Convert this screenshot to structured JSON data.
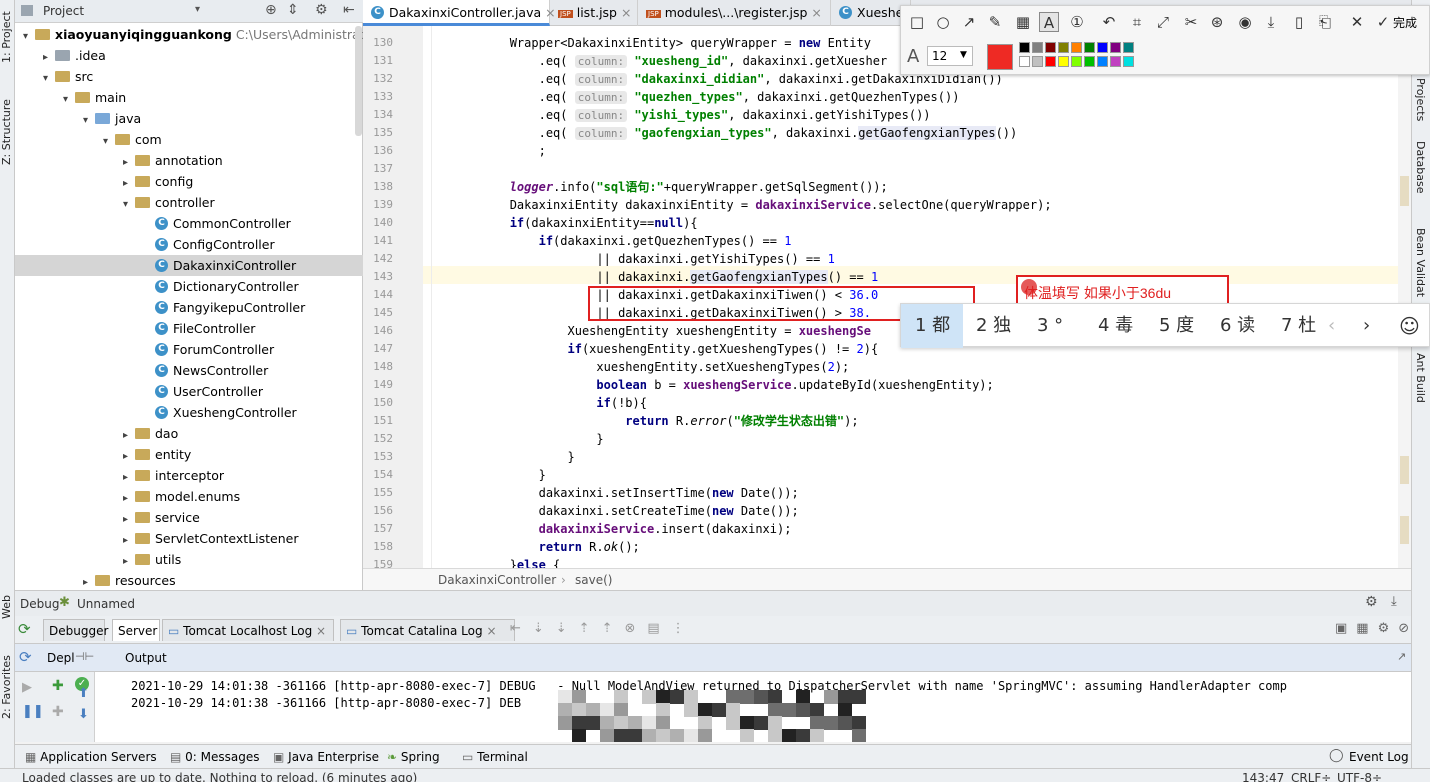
{
  "left_strip": {
    "project": "1: Project",
    "structure": "Z: Structure",
    "web": "Web",
    "favorites": "2: Favorites"
  },
  "project_panel": {
    "title": "Project",
    "rows": [
      {
        "indent": 0,
        "arrow": "▾",
        "icon": "folder",
        "label": "xiaoyuanyiqingguankong",
        "extra": "C:\\Users\\Administrator\\D",
        "bold": true
      },
      {
        "indent": 1,
        "arrow": "▸",
        "icon": "folder-gray",
        "label": ".idea"
      },
      {
        "indent": 1,
        "arrow": "▾",
        "icon": "folder",
        "label": "src"
      },
      {
        "indent": 2,
        "arrow": "▾",
        "icon": "folder",
        "label": "main"
      },
      {
        "indent": 3,
        "arrow": "▾",
        "icon": "folder-blue",
        "label": "java"
      },
      {
        "indent": 4,
        "arrow": "▾",
        "icon": "folder",
        "label": "com"
      },
      {
        "indent": 5,
        "arrow": "▸",
        "icon": "folder",
        "label": "annotation"
      },
      {
        "indent": 5,
        "arrow": "▸",
        "icon": "folder",
        "label": "config"
      },
      {
        "indent": 5,
        "arrow": "▾",
        "icon": "folder",
        "label": "controller"
      },
      {
        "indent": 6,
        "arrow": "",
        "icon": "class",
        "label": "CommonController"
      },
      {
        "indent": 6,
        "arrow": "",
        "icon": "class",
        "label": "ConfigController"
      },
      {
        "indent": 6,
        "arrow": "",
        "icon": "class",
        "label": "DakaxinxiController",
        "selected": true
      },
      {
        "indent": 6,
        "arrow": "",
        "icon": "class",
        "label": "DictionaryController"
      },
      {
        "indent": 6,
        "arrow": "",
        "icon": "class",
        "label": "FangyikepuController"
      },
      {
        "indent": 6,
        "arrow": "",
        "icon": "class",
        "label": "FileController"
      },
      {
        "indent": 6,
        "arrow": "",
        "icon": "class",
        "label": "ForumController"
      },
      {
        "indent": 6,
        "arrow": "",
        "icon": "class",
        "label": "NewsController"
      },
      {
        "indent": 6,
        "arrow": "",
        "icon": "class",
        "label": "UserController"
      },
      {
        "indent": 6,
        "arrow": "",
        "icon": "class",
        "label": "XueshengController"
      },
      {
        "indent": 5,
        "arrow": "▸",
        "icon": "folder",
        "label": "dao"
      },
      {
        "indent": 5,
        "arrow": "▸",
        "icon": "folder",
        "label": "entity"
      },
      {
        "indent": 5,
        "arrow": "▸",
        "icon": "folder",
        "label": "interceptor"
      },
      {
        "indent": 5,
        "arrow": "▸",
        "icon": "folder",
        "label": "model.enums"
      },
      {
        "indent": 5,
        "arrow": "▸",
        "icon": "folder",
        "label": "service"
      },
      {
        "indent": 5,
        "arrow": "▸",
        "icon": "folder",
        "label": "ServletContextListener"
      },
      {
        "indent": 5,
        "arrow": "▸",
        "icon": "folder",
        "label": "utils"
      },
      {
        "indent": 3,
        "arrow": "▸",
        "icon": "folder",
        "label": "resources"
      }
    ]
  },
  "editor_tabs": [
    {
      "label": "DakaxinxiController.java",
      "active": true,
      "icon": "C"
    },
    {
      "label": "list.jsp",
      "icon": "JSP"
    },
    {
      "label": "modules\\...\\register.jsp",
      "icon": "JSP"
    },
    {
      "label": "Xueshen",
      "icon": "C"
    }
  ],
  "code_lines": [
    {
      "n": "130",
      "html": "            Wrapper&lt;DakaxinxiEntity&gt; queryWrapper = <span class=\"kw\">new</span> Entity"
    },
    {
      "n": "131",
      "html": "                .eq( <span class=\"hint\">column:</span> <span class=\"str\">\"xuesheng_id\"</span>, dakaxinxi.getXuesher"
    },
    {
      "n": "132",
      "html": "                .eq( <span class=\"hint\">column:</span> <span class=\"str\">\"dakaxinxi_didian\"</span>, dakaxinxi.getDakaxinxiDidian())"
    },
    {
      "n": "133",
      "html": "                .eq( <span class=\"hint\">column:</span> <span class=\"str\">\"quezhen_types\"</span>, dakaxinxi.getQuezhenTypes())"
    },
    {
      "n": "134",
      "html": "                .eq( <span class=\"hint\">column:</span> <span class=\"str\">\"yishi_types\"</span>, dakaxinxi.getYishiTypes())"
    },
    {
      "n": "135",
      "html": "                .eq( <span class=\"hint\">column:</span> <span class=\"str\">\"gaofengxian_types\"</span>, dakaxinxi.<span class=\"mth\">getGaofengxianTypes</span>())"
    },
    {
      "n": "136",
      "html": "                ;"
    },
    {
      "n": "137",
      "html": ""
    },
    {
      "n": "138",
      "html": "            <span class=\"fld it\">logger</span>.info(<span class=\"str\">\"sql语句:\"</span>+queryWrapper.getSqlSegment());"
    },
    {
      "n": "139",
      "html": "            DakaxinxiEntity dakaxinxiEntity = <span class=\"fld\">dakaxinxiService</span>.selectOne(queryWrapper);"
    },
    {
      "n": "140",
      "html": "            <span class=\"kw\">if</span>(dakaxinxiEntity==<span class=\"kw\">null</span>){"
    },
    {
      "n": "141",
      "html": "                <span class=\"kw\">if</span>(dakaxinxi.getQuezhenTypes() == <span class=\"num\">1</span>"
    },
    {
      "n": "142",
      "html": "                        || dakaxinxi.getYishiTypes() == <span class=\"num\">1</span>"
    },
    {
      "n": "143",
      "html": "                        || dakaxinxi.<span class=\"mth\">getGaofengxianTypes</span>() == <span class=\"num\">1</span>"
    },
    {
      "n": "144",
      "html": "                        || dakaxinxi.getDakaxinxiTiwen() &lt; <span class=\"num\">36.0</span>"
    },
    {
      "n": "145",
      "html": "                        || dakaxinxi.getDakaxinxiTiwen() &gt; <span class=\"num\">38.</span>"
    },
    {
      "n": "146",
      "html": "                    XueshengEntity xueshengEntity = <span class=\"fld\">xueshengSe</span>"
    },
    {
      "n": "147",
      "html": "                    <span class=\"kw\">if</span>(xueshengEntity.getXueshengTypes() != <span class=\"num\">2</span>){"
    },
    {
      "n": "148",
      "html": "                        xueshengEntity.setXueshengTypes(<span class=\"num\">2</span>);"
    },
    {
      "n": "149",
      "html": "                        <span class=\"kw\">boolean</span> b = <span class=\"fld\">xueshengService</span>.updateById(xueshengEntity);"
    },
    {
      "n": "150",
      "html": "                        <span class=\"kw\">if</span>(!b){"
    },
    {
      "n": "151",
      "html": "                            <span class=\"kw\">return</span> R.<span class=\"it\">error</span>(<span class=\"str\">\"修改学生状态出错\"</span>);"
    },
    {
      "n": "152",
      "html": "                        }"
    },
    {
      "n": "153",
      "html": "                    }"
    },
    {
      "n": "154",
      "html": "                }"
    },
    {
      "n": "155",
      "html": "                dakaxinxi.setInsertTime(<span class=\"kw\">new</span> Date());"
    },
    {
      "n": "156",
      "html": "                dakaxinxi.setCreateTime(<span class=\"kw\">new</span> Date());"
    },
    {
      "n": "157",
      "html": "                <span class=\"fld\">dakaxinxiService</span>.insert(dakaxinxi);"
    },
    {
      "n": "158",
      "html": "                <span class=\"kw\">return</span> R.<span class=\"it\">ok</span>();"
    },
    {
      "n": "159",
      "html": "            }<span class=\"kw\">else</span> {"
    }
  ],
  "breadcrumb": {
    "cls": "DakaxinxiController",
    "method": "save()"
  },
  "annotation": {
    "text": "体温填写 如果小于36du"
  },
  "snip_toolbar": {
    "font_size": "12",
    "done_label": "完成",
    "selected_color": "#ee2a24",
    "colors_row1": [
      "#000000",
      "#808080",
      "#800000",
      "#808000",
      "#ff8000",
      "#008000",
      "#0000ff",
      "#800080",
      "#008080"
    ],
    "colors_row2": [
      "#ffffff",
      "#c0c0c0",
      "#ff0000",
      "#ffff00",
      "#80ff00",
      "#00c000",
      "#0080ff",
      "#c040c0",
      "#00e0e0"
    ]
  },
  "ime": {
    "candidates": [
      "1 都",
      "2 独",
      "3 °",
      "4 毒",
      "5 度",
      "6 读",
      "7 杜"
    ],
    "prev": "‹",
    "next": "›"
  },
  "debug": {
    "title": "Debug",
    "config": "Unnamed",
    "tabs": [
      "Debugger",
      "Server",
      "Tomcat Localhost Log",
      "Tomcat Catalina Log"
    ],
    "deploy_label": "Depl",
    "output_label": "Output",
    "log_lines": [
      "2021-10-29 14:01:38 -361166 [http-apr-8080-exec-7] DEBUG   - Null ModelAndView returned to DispatcherServlet with name 'SpringMVC': assuming HandlerAdapter comp",
      "2021-10-29 14:01:38 -361166 [http-apr-8080-exec-7] DEB"
    ]
  },
  "bottom_tabs": [
    "Application Servers",
    "0: Messages",
    "Java Enterprise",
    "Spring",
    "Terminal"
  ],
  "event_log": "Event Log",
  "right_strip": {
    "maven": "Maven Projects",
    "database": "Database",
    "bean": "Bean Validat",
    "ant": "Ant Build"
  },
  "status": {
    "message": "Loaded classes are up to date. Nothing to reload. (6 minutes ago)",
    "position": "143:47",
    "line_sep": "CRLF÷",
    "encoding": "UTF-8÷"
  }
}
